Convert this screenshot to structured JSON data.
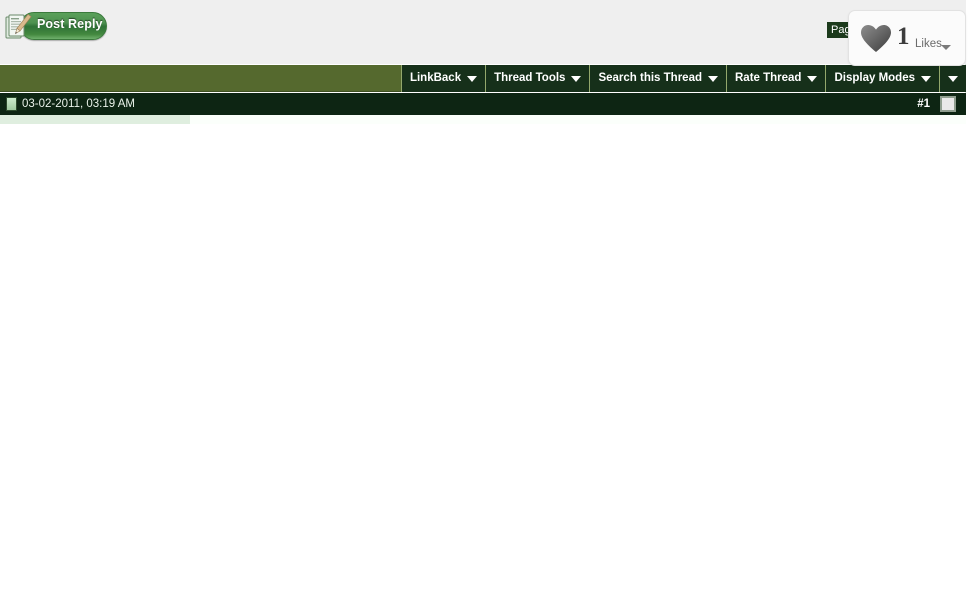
{
  "toolbar": {
    "post_reply_label": "Post Reply",
    "post_reply_icon": "notepad-pencil-icon",
    "page_badge_label": "Page"
  },
  "likes_widget": {
    "icon": "heart-icon",
    "count": "1",
    "label": "Likes",
    "caret_icon": "chevron-down-icon"
  },
  "menu_bar": {
    "items": [
      {
        "label": "LinkBack",
        "caret": "chevron-down-icon"
      },
      {
        "label": "Thread Tools",
        "caret": "chevron-down-icon"
      },
      {
        "label": "Search this Thread",
        "caret": "chevron-down-icon"
      },
      {
        "label": "Rate Thread",
        "caret": "chevron-down-icon"
      },
      {
        "label": "Display Modes",
        "caret": "chevron-down-icon"
      }
    ],
    "overflow_caret": "chevron-down-icon"
  },
  "post_header": {
    "date_icon": "post-status-icon",
    "date": "03-02-2011, 03:19 AM",
    "post_number": "#1",
    "permalink_icon": "post-permalink-icon"
  },
  "colors": {
    "menu_bar_olive": "#55692e",
    "menu_item_dark_green": "#16301a",
    "post_header_dark": "#0d2513",
    "top_strip_gray": "#efefef",
    "postbit_light_green": "#dfeedf",
    "post_reply_green": "#43883f"
  }
}
